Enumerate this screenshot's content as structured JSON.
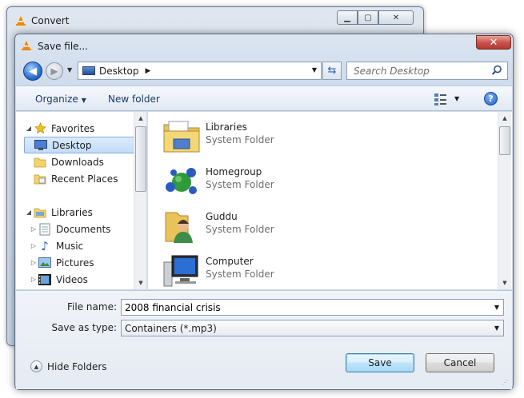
{
  "background_window": {
    "title": "Convert"
  },
  "dialog": {
    "title": "Save file...",
    "address": {
      "location": "Desktop"
    },
    "search": {
      "placeholder": "Search Desktop"
    },
    "toolbar": {
      "organize_label": "Organize",
      "new_folder_label": "New folder",
      "help_label": "?"
    },
    "nav_pane": {
      "items": [
        {
          "label": "Favorites",
          "level": 0,
          "icon": "star-icon",
          "expanded": true
        },
        {
          "label": "Desktop",
          "level": 1,
          "icon": "desktop-icon",
          "selected": true
        },
        {
          "label": "Downloads",
          "level": 1,
          "icon": "folder-icon"
        },
        {
          "label": "Recent Places",
          "level": 1,
          "icon": "recent-places-icon"
        },
        {
          "label": "Libraries",
          "level": 0,
          "icon": "libraries-icon",
          "expanded": true
        },
        {
          "label": "Documents",
          "level": 1,
          "icon": "documents-icon"
        },
        {
          "label": "Music",
          "level": 1,
          "icon": "music-icon"
        },
        {
          "label": "Pictures",
          "level": 1,
          "icon": "pictures-icon"
        },
        {
          "label": "Videos",
          "level": 1,
          "icon": "videos-icon"
        }
      ]
    },
    "files": [
      {
        "name": "Libraries",
        "type": "System Folder",
        "icon": "libraries-folder-icon"
      },
      {
        "name": "Homegroup",
        "type": "System Folder",
        "icon": "homegroup-icon"
      },
      {
        "name": "Guddu",
        "type": "System Folder",
        "icon": "user-folder-icon"
      },
      {
        "name": "Computer",
        "type": "System Folder",
        "icon": "computer-icon"
      }
    ],
    "filename": {
      "label": "File name:",
      "value": "2008 financial crisis"
    },
    "save_as_type": {
      "label": "Save as type:",
      "value": "Containers (*.mp3)"
    },
    "hide_folders_label": "Hide Folders",
    "save_label": "Save",
    "cancel_label": "Cancel"
  }
}
